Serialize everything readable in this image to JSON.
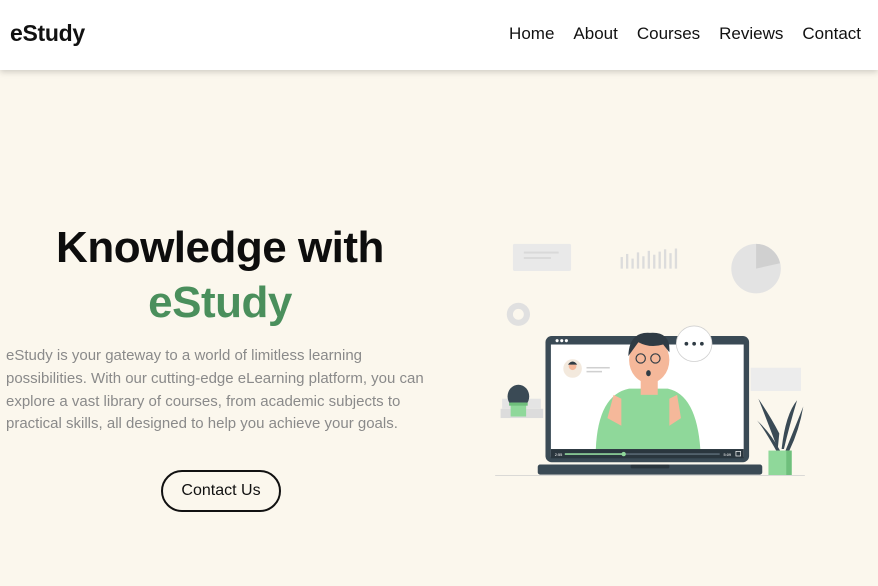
{
  "brand": {
    "logo": "eStudy"
  },
  "nav": {
    "items": [
      {
        "label": "Home"
      },
      {
        "label": "About"
      },
      {
        "label": "Courses"
      },
      {
        "label": "Reviews"
      },
      {
        "label": "Contact"
      }
    ]
  },
  "hero": {
    "title_line1": "Knowledge with",
    "title_line2": "eStudy",
    "description": "eStudy is your gateway to a world of limitless learning possibilities. With our cutting-edge eLearning platform, you can explore a vast library of courses, from academic subjects to practical skills, all designed to help you achieve your goals.",
    "cta_label": "Contact Us"
  },
  "illustration": {
    "video_current_time": "2:55",
    "video_total_time": "5:09",
    "progress": 0.38,
    "speech_bubble": "•••",
    "colors": {
      "accent_green": "#4a8f5c",
      "shirt_green": "#8fd89a",
      "laptop_dark": "#3a4a55",
      "light_gray": "#e6e6e6"
    }
  }
}
